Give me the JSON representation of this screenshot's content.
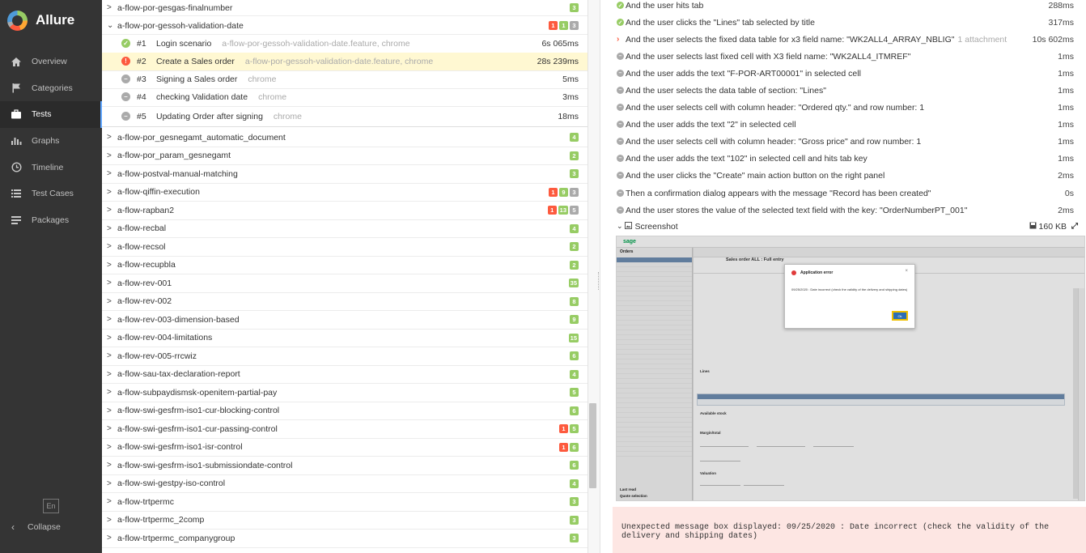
{
  "app": {
    "name": "Allure"
  },
  "sidebar": {
    "items": [
      {
        "label": "Overview",
        "icon": "home-icon"
      },
      {
        "label": "Categories",
        "icon": "flag-icon"
      },
      {
        "label": "Tests",
        "icon": "briefcase-icon",
        "active": true
      },
      {
        "label": "Graphs",
        "icon": "bar-chart-icon"
      },
      {
        "label": "Timeline",
        "icon": "clock-icon"
      },
      {
        "label": "Test Cases",
        "icon": "list-icon"
      },
      {
        "label": "Packages",
        "icon": "packages-icon"
      }
    ],
    "language": "En",
    "collapse_label": "Collapse"
  },
  "tree": {
    "top_group": {
      "name": "a-flow-por-gesgas-finalnumber",
      "badges": [
        {
          "type": "pass",
          "count": "3"
        }
      ]
    },
    "expanded_group": {
      "name": "a-flow-por-gessoh-validation-date",
      "badges": [
        {
          "type": "fail",
          "count": "1"
        },
        {
          "type": "pass",
          "count": "1"
        },
        {
          "type": "skip",
          "count": "3"
        }
      ]
    },
    "cases": [
      {
        "num": "#1",
        "name": "Login scenario",
        "meta": "a-flow-por-gessoh-validation-date.feature, chrome",
        "duration": "6s 065ms",
        "status": "pass"
      },
      {
        "num": "#2",
        "name": "Create a Sales order",
        "meta": "a-flow-por-gessoh-validation-date.feature, chrome",
        "duration": "28s 239ms",
        "status": "fail",
        "selected": true
      },
      {
        "num": "#3",
        "name": "Signing a Sales order",
        "meta": "chrome",
        "duration": "5ms",
        "status": "skip"
      },
      {
        "num": "#4",
        "name": "checking Validation date",
        "meta": "chrome",
        "duration": "3ms",
        "status": "skip"
      },
      {
        "num": "#5",
        "name": "Updating Order after signing",
        "meta": "chrome",
        "duration": "18ms",
        "status": "skip"
      }
    ],
    "groups": [
      {
        "name": "a-flow-por_gesnegamt_automatic_document",
        "badges": [
          {
            "type": "pass",
            "count": "4"
          }
        ]
      },
      {
        "name": "a-flow-por_param_gesnegamt",
        "badges": [
          {
            "type": "pass",
            "count": "2"
          }
        ]
      },
      {
        "name": "a-flow-postval-manual-matching",
        "badges": [
          {
            "type": "pass",
            "count": "3"
          }
        ]
      },
      {
        "name": "a-flow-qiffin-execution",
        "badges": [
          {
            "type": "fail",
            "count": "1"
          },
          {
            "type": "pass",
            "count": "9"
          },
          {
            "type": "skip",
            "count": "3"
          }
        ]
      },
      {
        "name": "a-flow-rapban2",
        "badges": [
          {
            "type": "fail",
            "count": "1"
          },
          {
            "type": "pass",
            "count": "13"
          },
          {
            "type": "skip",
            "count": "5"
          }
        ]
      },
      {
        "name": "a-flow-recbal",
        "badges": [
          {
            "type": "pass",
            "count": "4"
          }
        ]
      },
      {
        "name": "a-flow-recsol",
        "badges": [
          {
            "type": "pass",
            "count": "2"
          }
        ]
      },
      {
        "name": "a-flow-recupbla",
        "badges": [
          {
            "type": "pass",
            "count": "2"
          }
        ]
      },
      {
        "name": "a-flow-rev-001",
        "badges": [
          {
            "type": "pass",
            "count": "35"
          }
        ]
      },
      {
        "name": "a-flow-rev-002",
        "badges": [
          {
            "type": "pass",
            "count": "8"
          }
        ]
      },
      {
        "name": "a-flow-rev-003-dimension-based",
        "badges": [
          {
            "type": "pass",
            "count": "9"
          }
        ]
      },
      {
        "name": "a-flow-rev-004-limitations",
        "badges": [
          {
            "type": "pass",
            "count": "15"
          }
        ]
      },
      {
        "name": "a-flow-rev-005-rrcwiz",
        "badges": [
          {
            "type": "pass",
            "count": "6"
          }
        ]
      },
      {
        "name": "a-flow-sau-tax-declaration-report",
        "badges": [
          {
            "type": "pass",
            "count": "4"
          }
        ]
      },
      {
        "name": "a-flow-subpaydismsk-openitem-partial-pay",
        "badges": [
          {
            "type": "pass",
            "count": "5"
          }
        ]
      },
      {
        "name": "a-flow-swi-gesfrm-iso1-cur-blocking-control",
        "badges": [
          {
            "type": "pass",
            "count": "6"
          }
        ]
      },
      {
        "name": "a-flow-swi-gesfrm-iso1-cur-passing-control",
        "badges": [
          {
            "type": "fail",
            "count": "1"
          },
          {
            "type": "pass",
            "count": "5"
          }
        ]
      },
      {
        "name": "a-flow-swi-gesfrm-iso1-isr-control",
        "badges": [
          {
            "type": "fail",
            "count": "1"
          },
          {
            "type": "pass",
            "count": "6"
          }
        ]
      },
      {
        "name": "a-flow-swi-gesfrm-iso1-submissiondate-control",
        "badges": [
          {
            "type": "pass",
            "count": "6"
          }
        ]
      },
      {
        "name": "a-flow-swi-gestpy-iso-control",
        "badges": [
          {
            "type": "pass",
            "count": "4"
          }
        ]
      },
      {
        "name": "a-flow-trtpermc",
        "badges": [
          {
            "type": "pass",
            "count": "3"
          }
        ]
      },
      {
        "name": "a-flow-trtpermc_2comp",
        "badges": [
          {
            "type": "pass",
            "count": "3"
          }
        ]
      },
      {
        "name": "a-flow-trtpermc_companygroup",
        "badges": [
          {
            "type": "pass",
            "count": "3"
          }
        ]
      }
    ]
  },
  "details": {
    "steps": [
      {
        "text": "And the user hits tab",
        "duration": "288ms",
        "status": "pass"
      },
      {
        "text": "And the user clicks the \"Lines\" tab selected by title",
        "duration": "317ms",
        "status": "pass"
      },
      {
        "text": "And the user selects the fixed data table for x3 field name: \"WK2ALL4_ARRAY_NBLIG\"",
        "attachment": "1 attachment",
        "duration": "10s 602ms",
        "status": "fail"
      },
      {
        "text": "And the user selects last fixed cell with X3 field name: \"WK2ALL4_ITMREF\"",
        "duration": "1ms",
        "status": "skip"
      },
      {
        "text": "And the user adds the text \"F-POR-ART00001\" in selected cell",
        "duration": "1ms",
        "status": "skip"
      },
      {
        "text": "And the user selects the data table of section: \"Lines\"",
        "duration": "1ms",
        "status": "skip"
      },
      {
        "text": "And the user selects cell with column header: \"Ordered qty.\" and row number: 1",
        "duration": "1ms",
        "status": "skip"
      },
      {
        "text": "And the user adds the text \"2\" in selected cell",
        "duration": "1ms",
        "status": "skip"
      },
      {
        "text": "And the user selects cell with column header: \"Gross price\" and row number: 1",
        "duration": "1ms",
        "status": "skip"
      },
      {
        "text": "And the user adds the text \"102\" in selected cell and hits tab key",
        "duration": "1ms",
        "status": "skip"
      },
      {
        "text": "And the user clicks the \"Create\" main action button on the right panel",
        "duration": "2ms",
        "status": "skip"
      },
      {
        "text": "Then a confirmation dialog appears with the message \"Record has been created\"",
        "duration": "0s",
        "status": "skip"
      },
      {
        "text": "And the user stores the value of the selected text field with the key: \"OrderNumberPT_001\"",
        "duration": "2ms",
        "status": "skip"
      }
    ],
    "screenshot": {
      "label": "Screenshot",
      "size": "160 KB",
      "inner": {
        "brand": "sage",
        "left_title": "Orders",
        "title": "Sales order ALL : Full entry",
        "lines_title": "Lines",
        "available_stock": "Available stock",
        "margin_total": "Margin/total",
        "valuation": "Valuation",
        "last_read": "Last read",
        "quote_selection": "Quote selection",
        "dialog_title": "Application error",
        "dialog_message": "09/25/2020 : Date incorrect (check the validity of the delivery and shipping dates)",
        "dialog_ok": "Ok"
      }
    },
    "error_message": "Unexpected message box displayed: 09/25/2020 : Date incorrect (check the validity of the delivery and shipping dates)"
  }
}
